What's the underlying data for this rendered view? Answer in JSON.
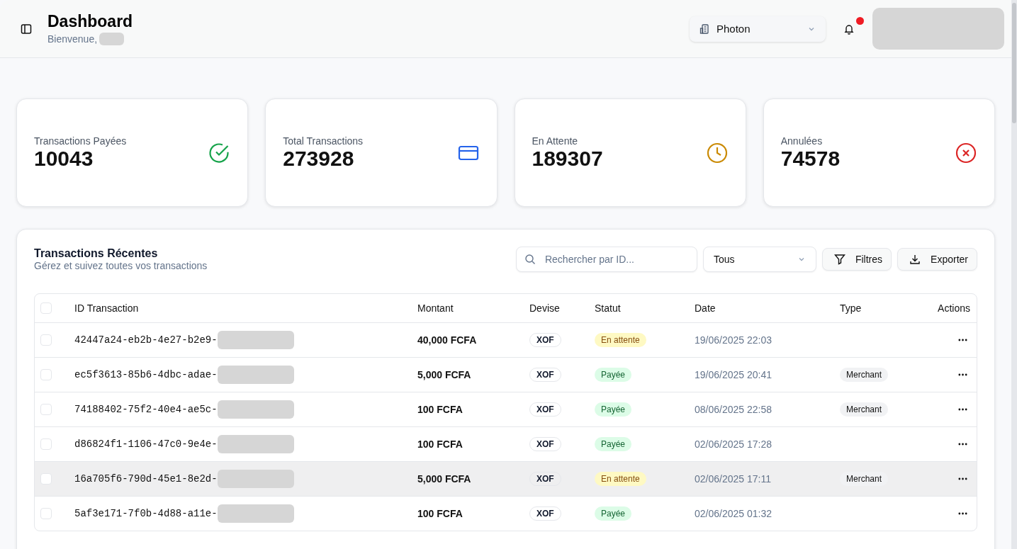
{
  "header": {
    "title": "Dashboard",
    "greeting": "Bienvenue,",
    "organization": "Photon",
    "notification_unread": true
  },
  "stats": [
    {
      "label": "Transactions Payées",
      "value": "10043",
      "kind": "check",
      "color": "#16a34a"
    },
    {
      "label": "Total Transactions",
      "value": "273928",
      "kind": "card",
      "color": "#2563eb"
    },
    {
      "label": "En Attente",
      "value": "189307",
      "kind": "clock",
      "color": "#ca8a04"
    },
    {
      "label": "Annulées",
      "value": "74578",
      "kind": "cancel",
      "color": "#dc2626"
    }
  ],
  "transactions": {
    "title": "Transactions Récentes",
    "subtitle": "Gérez et suivez toutes vos transactions",
    "search": {
      "placeholder": "Rechercher par ID..."
    },
    "status_filter": "Tous",
    "buttons": [
      "Filtres",
      "Exporter"
    ],
    "select_all_checked": false,
    "columns": [
      "ID Transaction",
      "Montant",
      "Devise",
      "Statut",
      "Date",
      "Type",
      "Actions"
    ],
    "rows": [
      {
        "id": "42447a24-eb2b-4e27-b2e9-",
        "id_redacted": true,
        "amount": "40,000 FCFA",
        "currency": "XOF",
        "status": "En attente",
        "pending": true,
        "date": "19/06/2025 22:03",
        "type": "",
        "checked": false,
        "hovered": false
      },
      {
        "id": "ec5f3613-85b6-4dbc-adae-",
        "id_redacted": true,
        "amount": "5,000 FCFA",
        "currency": "XOF",
        "status": "Payée",
        "pending": false,
        "date": "19/06/2025 20:41",
        "type": "Merchant",
        "checked": false,
        "hovered": false
      },
      {
        "id": "74188402-75f2-40e4-ae5c-",
        "id_redacted": true,
        "amount": "100 FCFA",
        "currency": "XOF",
        "status": "Payée",
        "pending": false,
        "date": "08/06/2025 22:58",
        "type": "Merchant",
        "checked": false,
        "hovered": false
      },
      {
        "id": "d86824f1-1106-47c0-9e4e-",
        "id_redacted": true,
        "amount": "100 FCFA",
        "currency": "XOF",
        "status": "Payée",
        "pending": false,
        "date": "02/06/2025 17:28",
        "type": "",
        "checked": false,
        "hovered": false
      },
      {
        "id": "16a705f6-790d-45e1-8e2d-",
        "id_redacted": true,
        "amount": "5,000 FCFA",
        "currency": "XOF",
        "status": "En attente",
        "pending": true,
        "date": "02/06/2025 17:11",
        "type": "Merchant",
        "checked": false,
        "hovered": true
      },
      {
        "id": "5af3e171-7f0b-4d88-a11e-",
        "id_redacted": true,
        "amount": "100 FCFA",
        "currency": "XOF",
        "status": "Payée",
        "pending": false,
        "date": "02/06/2025 01:32",
        "type": "",
        "checked": false,
        "hovered": false
      }
    ]
  }
}
